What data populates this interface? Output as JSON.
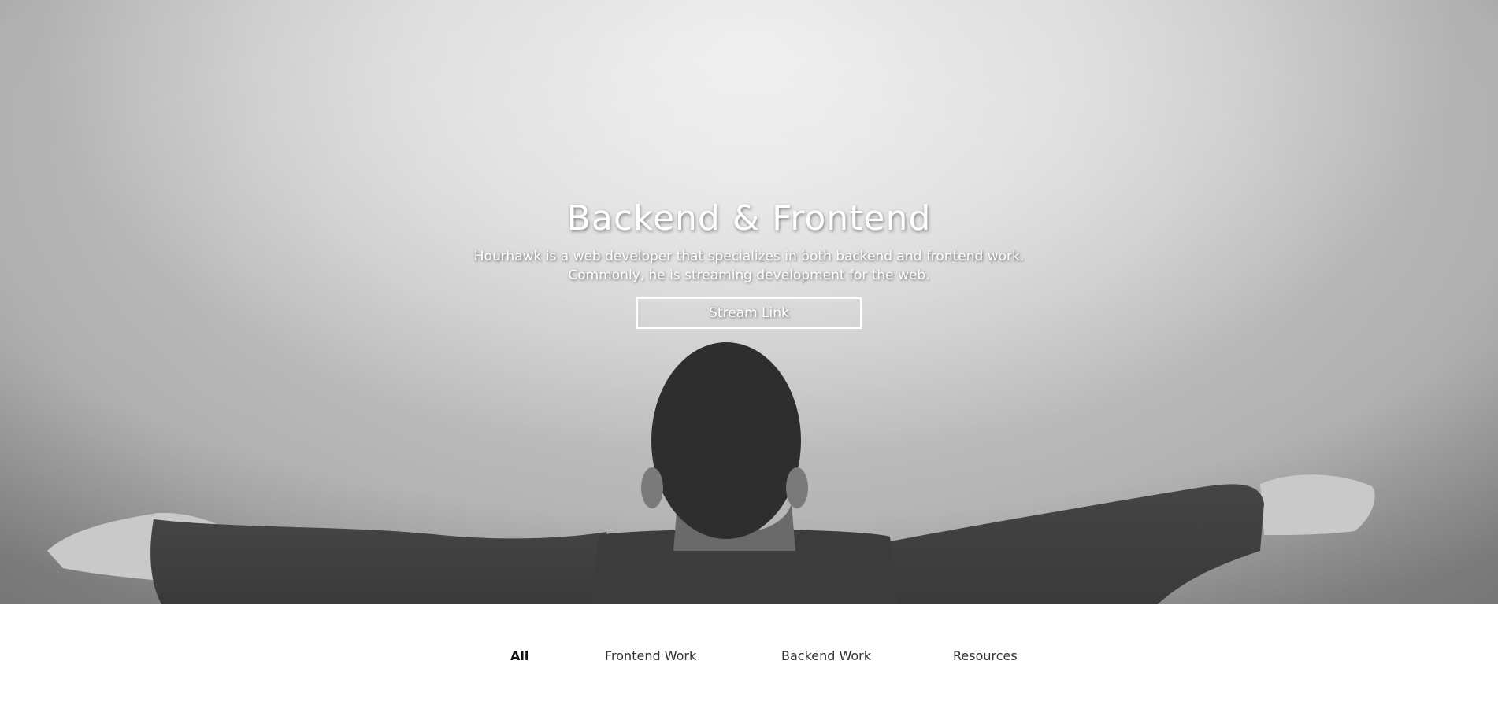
{
  "hero": {
    "title": "Backend & Frontend",
    "description_line1": "Hourhawk is a web developer that specializes in both backend and frontend work.",
    "description_line2": "Commonly, he is streaming development for the web.",
    "button_label": "Stream Link"
  },
  "filters": {
    "items": [
      {
        "label": "All"
      },
      {
        "label": "Frontend Work"
      },
      {
        "label": "Backend Work"
      },
      {
        "label": "Resources"
      }
    ],
    "active": "All"
  },
  "colors": {
    "text_light": "#ffffff",
    "nav_text": "#333333",
    "background": "#ffffff"
  }
}
